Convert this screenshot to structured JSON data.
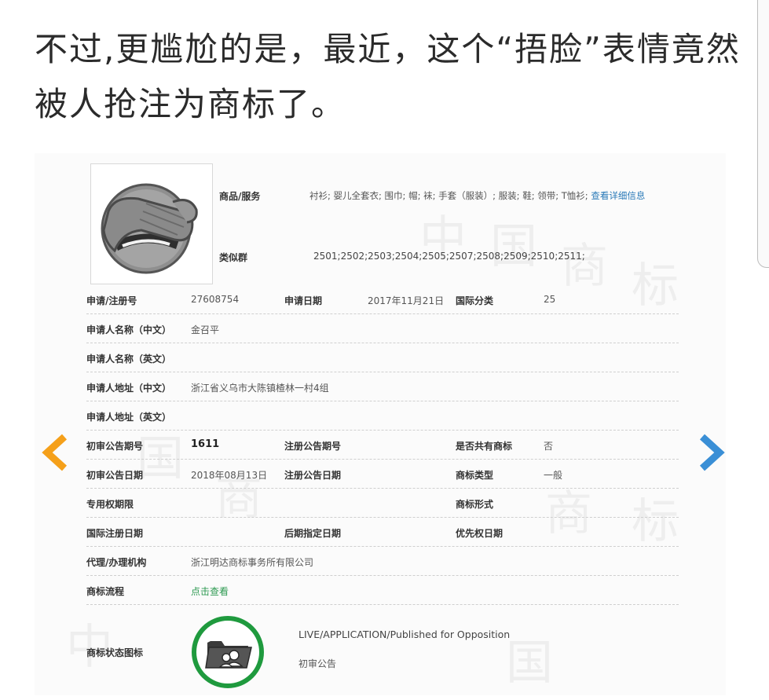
{
  "post": {
    "headline": "不过,更尴尬的是，最近，这个“捂脸”表情竟然被人抢注为商标了。"
  },
  "record": {
    "goods_label": "商品/服务",
    "goods_value": "衬衫; 婴儿全套衣; 围巾; 帽; 袜; 手套（服装）; 服装; 鞋; 领带; T恤衫; ",
    "goods_link": "查看详细信息",
    "similar_label": "类似群",
    "similar_value": "2501;2502;2503;2504;2505;2507;2508;2509;2510;2511;",
    "rows": [
      {
        "l1": "申请/注册号",
        "v1": "27608754",
        "l2": "申请日期",
        "v2": "2017年11月21日",
        "l3": "国际分类",
        "v3": "25"
      },
      {
        "l1": "申请人名称（中文）",
        "v1": "金召平"
      },
      {
        "l1": "申请人名称（英文）",
        "v1": ""
      },
      {
        "l1": "申请人地址（中文）",
        "v1": "浙江省义乌市大陈镇楂林一村4组"
      },
      {
        "l1": "申请人地址（英文）",
        "v1": ""
      },
      {
        "l1": "初审公告期号",
        "v1": "1611",
        "l2": "注册公告期号",
        "v2": "",
        "l3": "是否共有商标",
        "v3": "否"
      },
      {
        "l1": "初审公告日期",
        "v1": "2018年08月13日",
        "l2": "注册公告日期",
        "v2": "",
        "l3": "商标类型",
        "v3": "一般"
      },
      {
        "l1": "专用权期限",
        "v1": "",
        "l3": "商标形式",
        "v3": ""
      },
      {
        "l1": "国际注册日期",
        "v1": "",
        "l2": "后期指定日期",
        "v2": "",
        "l3": "优先权日期",
        "v3": ""
      },
      {
        "l1": "代理/办理机构",
        "v1": "浙江明达商标事务所有限公司"
      },
      {
        "l1": "商标流程",
        "v1": "点击查看"
      }
    ],
    "status_label": "商标状态图标",
    "status_en": "LIVE/APPLICATION/Published for Opposition",
    "status_cn": "初审公告"
  },
  "watermark": {
    "chars": [
      "中",
      "国",
      "商",
      "标"
    ]
  },
  "colors": {
    "link_blue": "#2a7ab8",
    "link_green": "#2e9a52",
    "status_ring": "#1f9a3e",
    "prev_arrow": "#f5a01a",
    "next_arrow": "#3a8fd6"
  },
  "icons": {
    "logo": "facepalm-emoji-icon",
    "status": "shared-folder-icon",
    "prev": "chevron-left-icon",
    "next": "chevron-right-icon"
  }
}
